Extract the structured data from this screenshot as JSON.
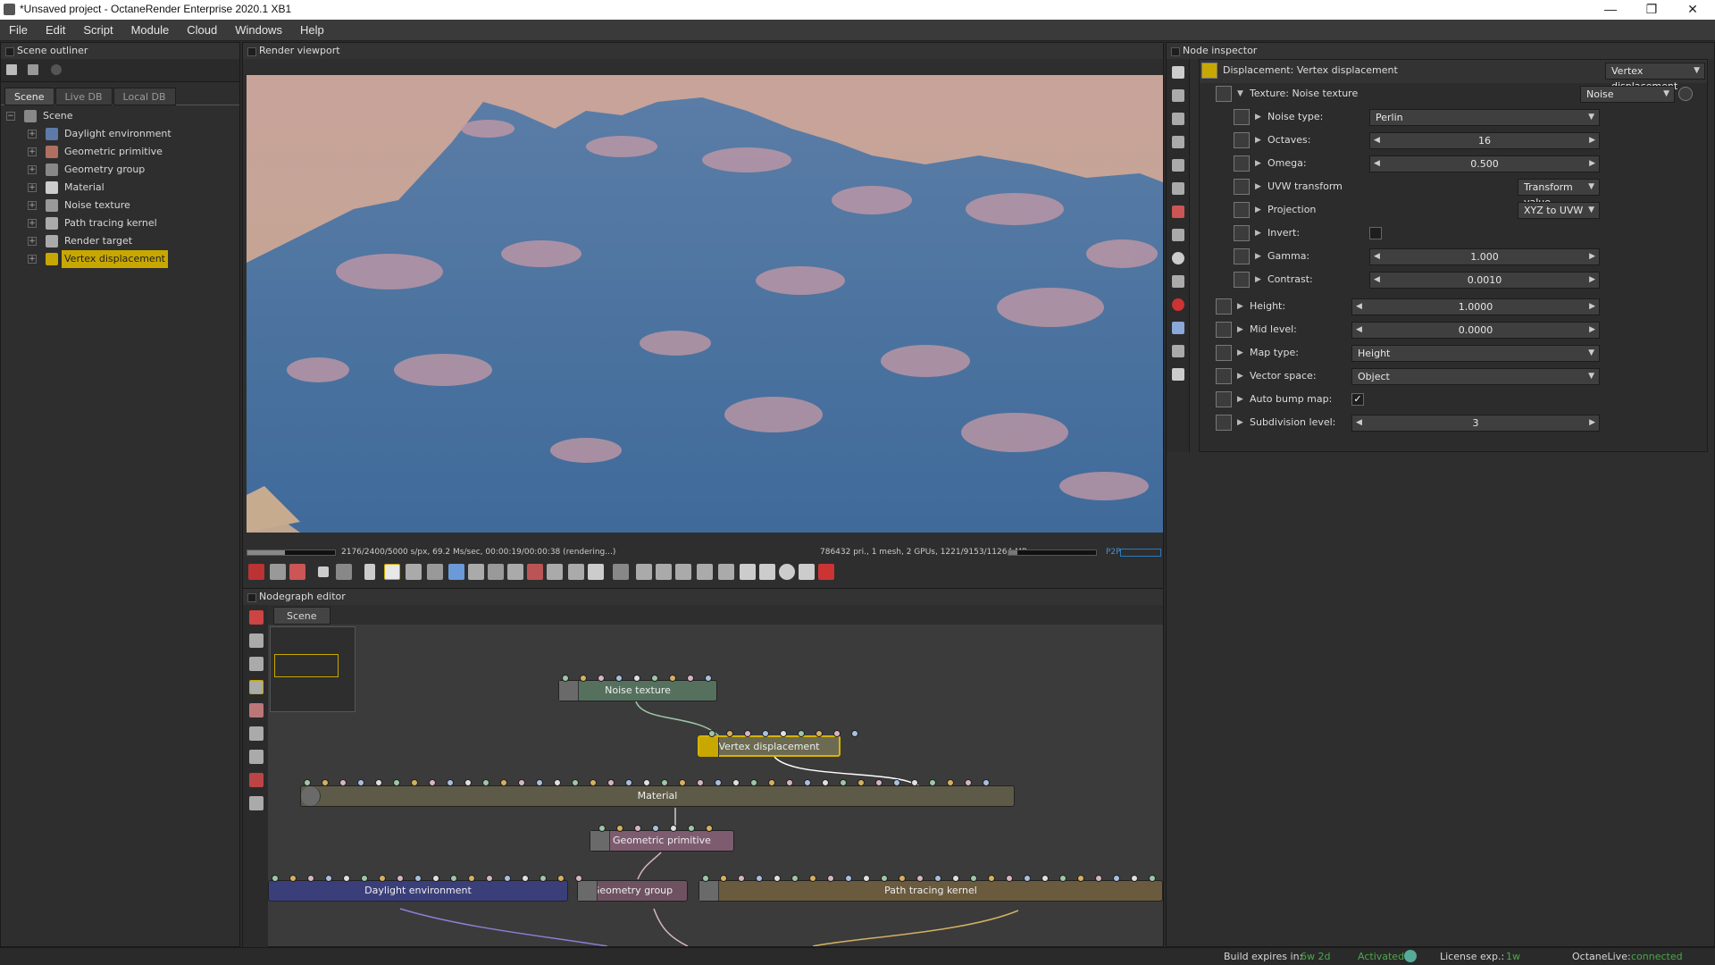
{
  "window": {
    "title": "*Unsaved project - OctaneRender Enterprise 2020.1 XB1",
    "min": "—",
    "max": "❐",
    "close": "✕"
  },
  "menu": [
    "File",
    "Edit",
    "Script",
    "Module",
    "Cloud",
    "Windows",
    "Help"
  ],
  "outliner": {
    "title": "Scene outliner",
    "tabs": [
      "Scene",
      "Live DB",
      "Local DB"
    ],
    "root": "Scene",
    "items": [
      {
        "label": "Daylight environment",
        "color": "#5d7aa8"
      },
      {
        "label": "Geometric primitive",
        "color": "#b07060"
      },
      {
        "label": "Geometry group",
        "color": "#888"
      },
      {
        "label": "Material",
        "color": "#ccc"
      },
      {
        "label": "Noise texture",
        "color": "#999"
      },
      {
        "label": "Path tracing kernel",
        "color": "#aaa"
      },
      {
        "label": "Render target",
        "color": "#aaa"
      },
      {
        "label": "Vertex displacement",
        "color": "#c8a800",
        "selected": true
      }
    ]
  },
  "viewport": {
    "title": "Render viewport",
    "status_left": "2176/2400/5000 s/px, 69.2 Ms/sec, 00:00:19/00:00:38 (rendering...)",
    "status_right": "786432 pri., 1 mesh, 2 GPUs, 1221/9153/11264 MB",
    "p2p": "P2P",
    "progress": 0.43
  },
  "nodegraph": {
    "title": "Nodegraph editor",
    "tab": "Scene",
    "nodes": {
      "noise": "Noise texture",
      "vdisp": "Vertex displacement",
      "material": "Material",
      "geoprim": "Geometric primitive",
      "daylight": "Daylight environment",
      "geogroup": "Geometry group",
      "ptk": "Path tracing kernel"
    }
  },
  "inspector": {
    "title": "Node inspector",
    "header": "Displacement: Vertex displacement",
    "header_type": "Vertex displacement",
    "texture_label": "Texture: Noise texture",
    "texture_type": "Noise",
    "noise_type": {
      "label": "Noise type:",
      "value": "Perlin"
    },
    "octaves": {
      "label": "Octaves:",
      "value": "16"
    },
    "omega": {
      "label": "Omega:",
      "value": "0.500"
    },
    "uvw": {
      "label": "UVW transform",
      "value": "Transform value"
    },
    "projection": {
      "label": "Projection",
      "value": "XYZ to UVW"
    },
    "invert": {
      "label": "Invert:"
    },
    "gamma": {
      "label": "Gamma:",
      "value": "1.000"
    },
    "contrast": {
      "label": "Contrast:",
      "value": "0.0010"
    },
    "height": {
      "label": "Height:",
      "value": "1.0000"
    },
    "midlevel": {
      "label": "Mid level:",
      "value": "0.0000"
    },
    "maptype": {
      "label": "Map type:",
      "value": "Height"
    },
    "vectorspace": {
      "label": "Vector space:",
      "value": "Object"
    },
    "autobump": {
      "label": "Auto bump map:",
      "check": "✓"
    },
    "subdiv": {
      "label": "Subdivision level:",
      "value": "3"
    }
  },
  "bottombar": {
    "build_label": "Build expires in:",
    "build_value": "6w 2d",
    "activated": "Activated",
    "license_label": "License exp.:",
    "license_value": "1w",
    "live_label": "OctaneLive:",
    "live_value": "connected"
  }
}
